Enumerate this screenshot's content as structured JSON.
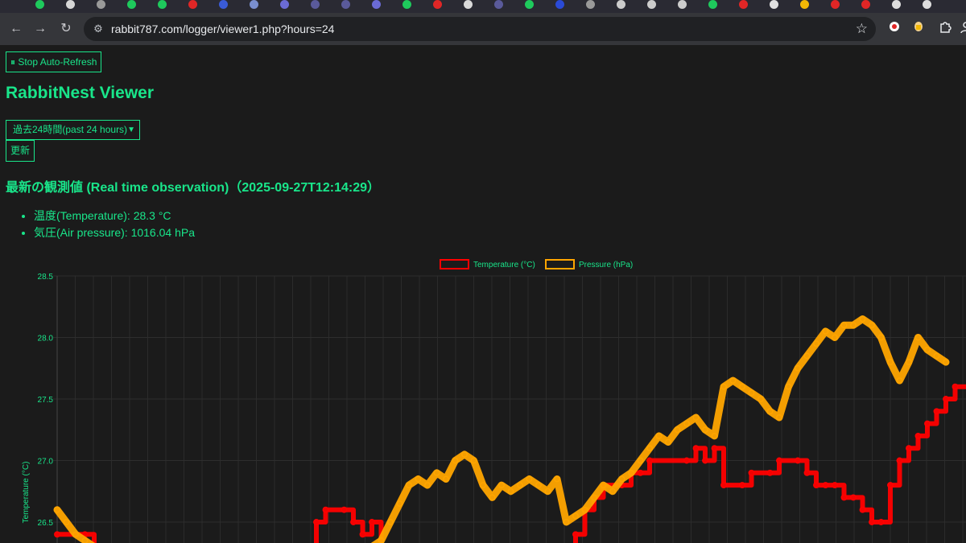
{
  "browser": {
    "url": "rabbit787.com/logger/viewer1.php?hours=24",
    "tab_favicons": [
      "#1ec95c",
      "#d6d6d6",
      "#999999",
      "#1ec95c",
      "#1ec95c",
      "#e02626",
      "#3a5bd6",
      "#7a8fcf",
      "#6b6bd6",
      "#5a5a9a",
      "#5a5a9a",
      "#6b6bd6",
      "#1ec95c",
      "#e02626",
      "#d9d9d9",
      "#5a5a9a",
      "#1ec95c",
      "#2a4ad6",
      "#999999",
      "#cccccc",
      "#cccccc",
      "#cccccc",
      "#1ec95c",
      "#e02626",
      "#e0e0e0",
      "#f2b705",
      "#e02626",
      "#e02626",
      "#dddddd",
      "#dddddd"
    ],
    "extensions": [
      {
        "icon": "record-icon",
        "color": "#e0e0e0"
      },
      {
        "icon": "extension-badge-icon",
        "color": "#f2b705"
      },
      {
        "icon": "puzzle-icon",
        "color": "#e8eaed"
      },
      {
        "icon": "profile-icon",
        "color": "#e8eaed"
      }
    ]
  },
  "page": {
    "auto_refresh_label": "⏸ Stop Auto-Refresh",
    "title": "RabbitNest Viewer",
    "range_select_value": "過去24時間(past 24 hours)",
    "update_label": "更新",
    "latest_heading": "最新の観測値 (Real time observation)（2025-09-27T12:14:29）",
    "observations": [
      "温度(Temperature): 28.3 °C",
      "気圧(Air pressure): 1016.04 hPa"
    ]
  },
  "chart_data": {
    "type": "line",
    "y_axis": {
      "label": "Temperature (°C)",
      "ticks": [
        "28.5",
        "28.0",
        "27.5",
        "27.0",
        "26.5"
      ],
      "ylim_visible": [
        26.35,
        28.5
      ]
    },
    "grid": true,
    "legend_position": "top-center",
    "series": [
      {
        "name": "Temperature (°C)",
        "color": "#ff0000",
        "points": [
          [
            0,
            26.4
          ],
          [
            3,
            26.4
          ],
          [
            4,
            26.3
          ],
          [
            12,
            26.3
          ],
          [
            27,
            26.3
          ],
          [
            28,
            26.5
          ],
          [
            29,
            26.6
          ],
          [
            31,
            26.6
          ],
          [
            32,
            26.5
          ],
          [
            33,
            26.4
          ],
          [
            34,
            26.5
          ],
          [
            35,
            26.3
          ],
          [
            48,
            26.3
          ],
          [
            55,
            26.3
          ],
          [
            56,
            26.4
          ],
          [
            57,
            26.6
          ],
          [
            58,
            26.7
          ],
          [
            59,
            26.8
          ],
          [
            61,
            26.8
          ],
          [
            62,
            26.9
          ],
          [
            63,
            26.9
          ],
          [
            64,
            27.0
          ],
          [
            68,
            27.0
          ],
          [
            69,
            27.1
          ],
          [
            70,
            27.0
          ],
          [
            71,
            27.1
          ],
          [
            72,
            26.8
          ],
          [
            74,
            26.8
          ],
          [
            75,
            26.9
          ],
          [
            77,
            26.9
          ],
          [
            78,
            27.0
          ],
          [
            80,
            27.0
          ],
          [
            81,
            26.9
          ],
          [
            82,
            26.8
          ],
          [
            83,
            26.8
          ],
          [
            84,
            26.8
          ],
          [
            85,
            26.7
          ],
          [
            86,
            26.7
          ],
          [
            87,
            26.6
          ],
          [
            88,
            26.5
          ],
          [
            89,
            26.5
          ],
          [
            90,
            26.8
          ],
          [
            91,
            27.0
          ],
          [
            92,
            27.1
          ],
          [
            93,
            27.2
          ],
          [
            94,
            27.3
          ],
          [
            95,
            27.4
          ],
          [
            96,
            27.5
          ],
          [
            97,
            27.6
          ],
          [
            99,
            27.6
          ],
          [
            100,
            27.7
          ]
        ]
      },
      {
        "name": "Pressure (hPa)",
        "color": "#ffa500",
        "points": [
          [
            0,
            26.6
          ],
          [
            1,
            26.5
          ],
          [
            2,
            26.4
          ],
          [
            3,
            26.35
          ],
          [
            4,
            26.3
          ],
          [
            33,
            26.3
          ],
          [
            34,
            26.3
          ],
          [
            35,
            26.35
          ],
          [
            36,
            26.5
          ],
          [
            37,
            26.65
          ],
          [
            38,
            26.8
          ],
          [
            39,
            26.85
          ],
          [
            40,
            26.8
          ],
          [
            41,
            26.9
          ],
          [
            42,
            26.85
          ],
          [
            43,
            27.0
          ],
          [
            44,
            27.05
          ],
          [
            45,
            27.0
          ],
          [
            46,
            26.8
          ],
          [
            47,
            26.7
          ],
          [
            48,
            26.8
          ],
          [
            49,
            26.75
          ],
          [
            50,
            26.8
          ],
          [
            51,
            26.85
          ],
          [
            52,
            26.8
          ],
          [
            53,
            26.75
          ],
          [
            54,
            26.85
          ],
          [
            55,
            26.5
          ],
          [
            56,
            26.55
          ],
          [
            57,
            26.6
          ],
          [
            58,
            26.7
          ],
          [
            59,
            26.8
          ],
          [
            60,
            26.75
          ],
          [
            61,
            26.85
          ],
          [
            62,
            26.9
          ],
          [
            63,
            27.0
          ],
          [
            64,
            27.1
          ],
          [
            65,
            27.2
          ],
          [
            66,
            27.15
          ],
          [
            67,
            27.25
          ],
          [
            68,
            27.3
          ],
          [
            69,
            27.35
          ],
          [
            70,
            27.25
          ],
          [
            71,
            27.2
          ],
          [
            72,
            27.6
          ],
          [
            73,
            27.65
          ],
          [
            74,
            27.6
          ],
          [
            75,
            27.55
          ],
          [
            76,
            27.5
          ],
          [
            77,
            27.4
          ],
          [
            78,
            27.35
          ],
          [
            79,
            27.6
          ],
          [
            80,
            27.75
          ],
          [
            81,
            27.85
          ],
          [
            82,
            27.95
          ],
          [
            83,
            28.05
          ],
          [
            84,
            28.0
          ],
          [
            85,
            28.1
          ],
          [
            86,
            28.1
          ],
          [
            87,
            28.15
          ],
          [
            88,
            28.1
          ],
          [
            89,
            28.0
          ],
          [
            90,
            27.8
          ],
          [
            91,
            27.65
          ],
          [
            92,
            27.8
          ],
          [
            93,
            28.0
          ],
          [
            94,
            27.9
          ],
          [
            95,
            27.85
          ],
          [
            96,
            27.8
          ]
        ]
      }
    ]
  }
}
